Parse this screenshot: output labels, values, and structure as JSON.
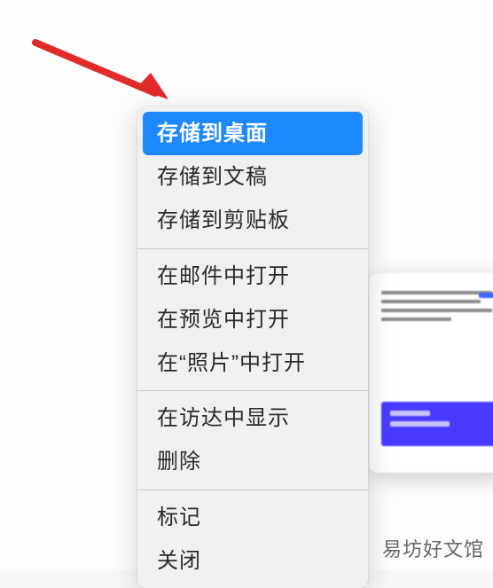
{
  "menu": {
    "groups": [
      [
        {
          "label": "存储到桌面",
          "selected": true
        },
        {
          "label": "存储到文稿",
          "selected": false
        },
        {
          "label": "存储到剪贴板",
          "selected": false
        }
      ],
      [
        {
          "label": "在邮件中打开",
          "selected": false
        },
        {
          "label": "在预览中打开",
          "selected": false
        },
        {
          "label": "在“照片”中打开",
          "selected": false
        }
      ],
      [
        {
          "label": "在访达中显示",
          "selected": false
        },
        {
          "label": "删除",
          "selected": false
        }
      ],
      [
        {
          "label": "标记",
          "selected": false
        },
        {
          "label": "关闭",
          "selected": false
        }
      ]
    ]
  },
  "colors": {
    "selection": "#1e88ff",
    "arrow": "#e12a2a",
    "banner": "#4a3aff"
  },
  "watermark": "易坊好文馆"
}
